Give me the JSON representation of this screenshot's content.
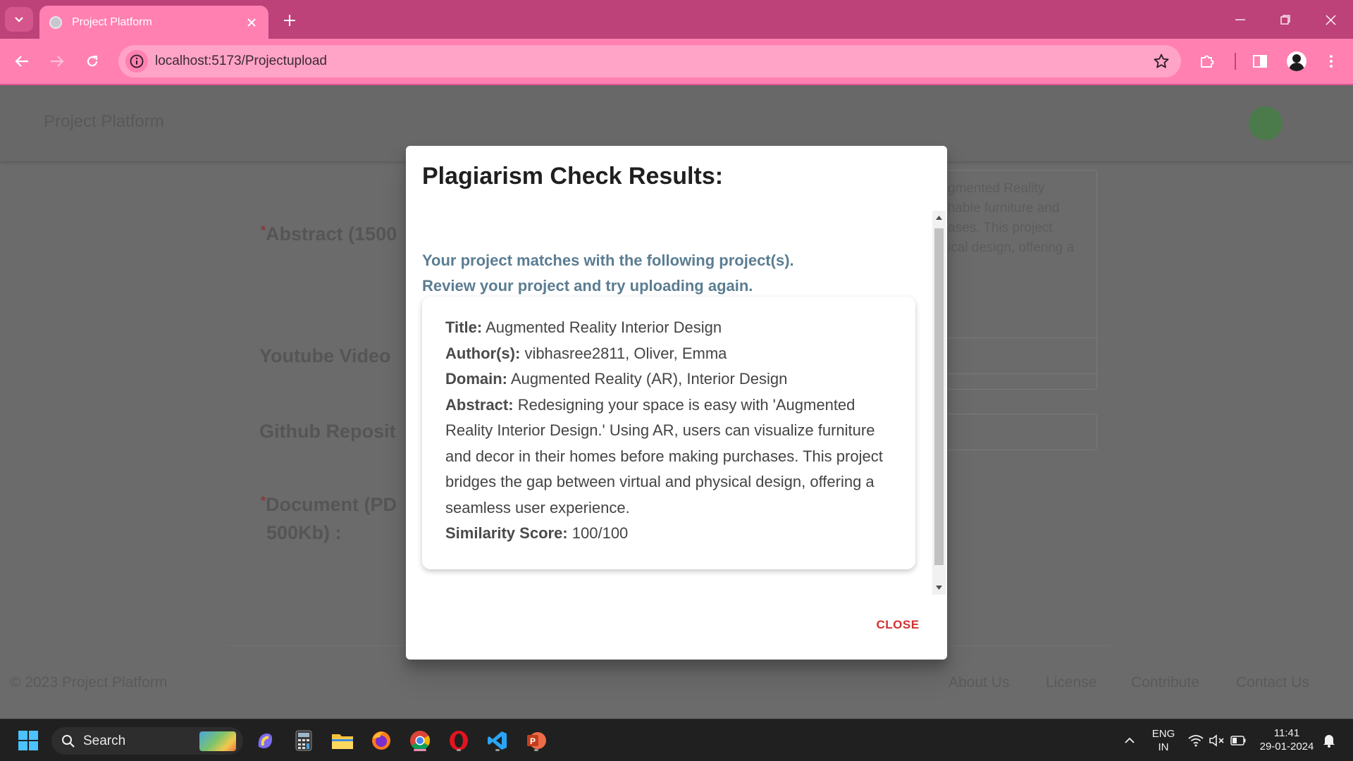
{
  "browser": {
    "tab_title": "Project Platform",
    "url": "localhost:5173/Projectupload"
  },
  "background_page": {
    "app_title": "Project Platform",
    "labels": {
      "abstract": "Abstract (1500",
      "youtube": "Youtube Video",
      "github": "Github Reposit",
      "document": "Document (PD",
      "document_sub": "500Kb) :"
    },
    "abstract_snippet": "gmented Reality\nhable furniture and\nases. This project\nical design, offering a",
    "footer": {
      "copyright": "© 2023 Project Platform",
      "links": [
        "About Us",
        "License",
        "Contribute",
        "Contact Us"
      ]
    }
  },
  "dialog": {
    "title": "Plagiarism Check Results:",
    "message_line1": "Your project matches with the following project(s).",
    "message_line2": "Review your project and try uploading again.",
    "result": {
      "title_key": "Title:",
      "title_value": "Augmented Reality Interior Design",
      "authors_key": "Author(s):",
      "authors_value": "vibhasree2811, Oliver, Emma",
      "domain_key": "Domain:",
      "domain_value": "Augmented Reality (AR), Interior Design",
      "abstract_key": "Abstract:",
      "abstract_value": "Redesigning your space is easy with 'Augmented Reality Interior Design.' Using AR, users can visualize furniture and decor in their homes before making purchases. This project bridges the gap between virtual and physical design, offering a seamless user experience.",
      "score_key": "Similarity Score:",
      "score_value": "100/100"
    },
    "close_label": "CLOSE"
  },
  "taskbar": {
    "search_placeholder": "Search",
    "language_line1": "ENG",
    "language_line2": "IN",
    "time": "11:41",
    "date": "29-01-2024"
  },
  "colors": {
    "tabbar": "#bd4279",
    "toolbar": "#ff80b1",
    "dialog_message": "#5b7d92",
    "close_button": "#d32f2f"
  }
}
